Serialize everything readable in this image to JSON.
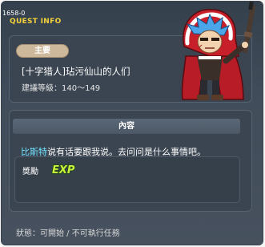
{
  "window": {
    "quest_id": "1658-0",
    "header_title": "QUEST INFO"
  },
  "quest": {
    "category_badge": "主要",
    "title": "[十字猎人]玷污仙山的人们",
    "recommended_level": "建議等級：140～149"
  },
  "content": {
    "header": "內容",
    "npc_name": "比斯特",
    "dialog_rest": "说有话要跟我说。去问问是什么事情吧。"
  },
  "reward": {
    "label": "獎勵",
    "exp_icon_text": "EXP"
  },
  "status": {
    "text": "狀態：可開始 / 不可執行任務"
  },
  "colors": {
    "accent_yellow": "#f2d13a",
    "npc_name_cyan": "#6fe2ff",
    "exp_green": "#c8f03c",
    "badge_tan": "#cdb89b"
  },
  "icons": {
    "portrait": "hooded-hunter-character-portrait",
    "reward": "exp-icon"
  }
}
